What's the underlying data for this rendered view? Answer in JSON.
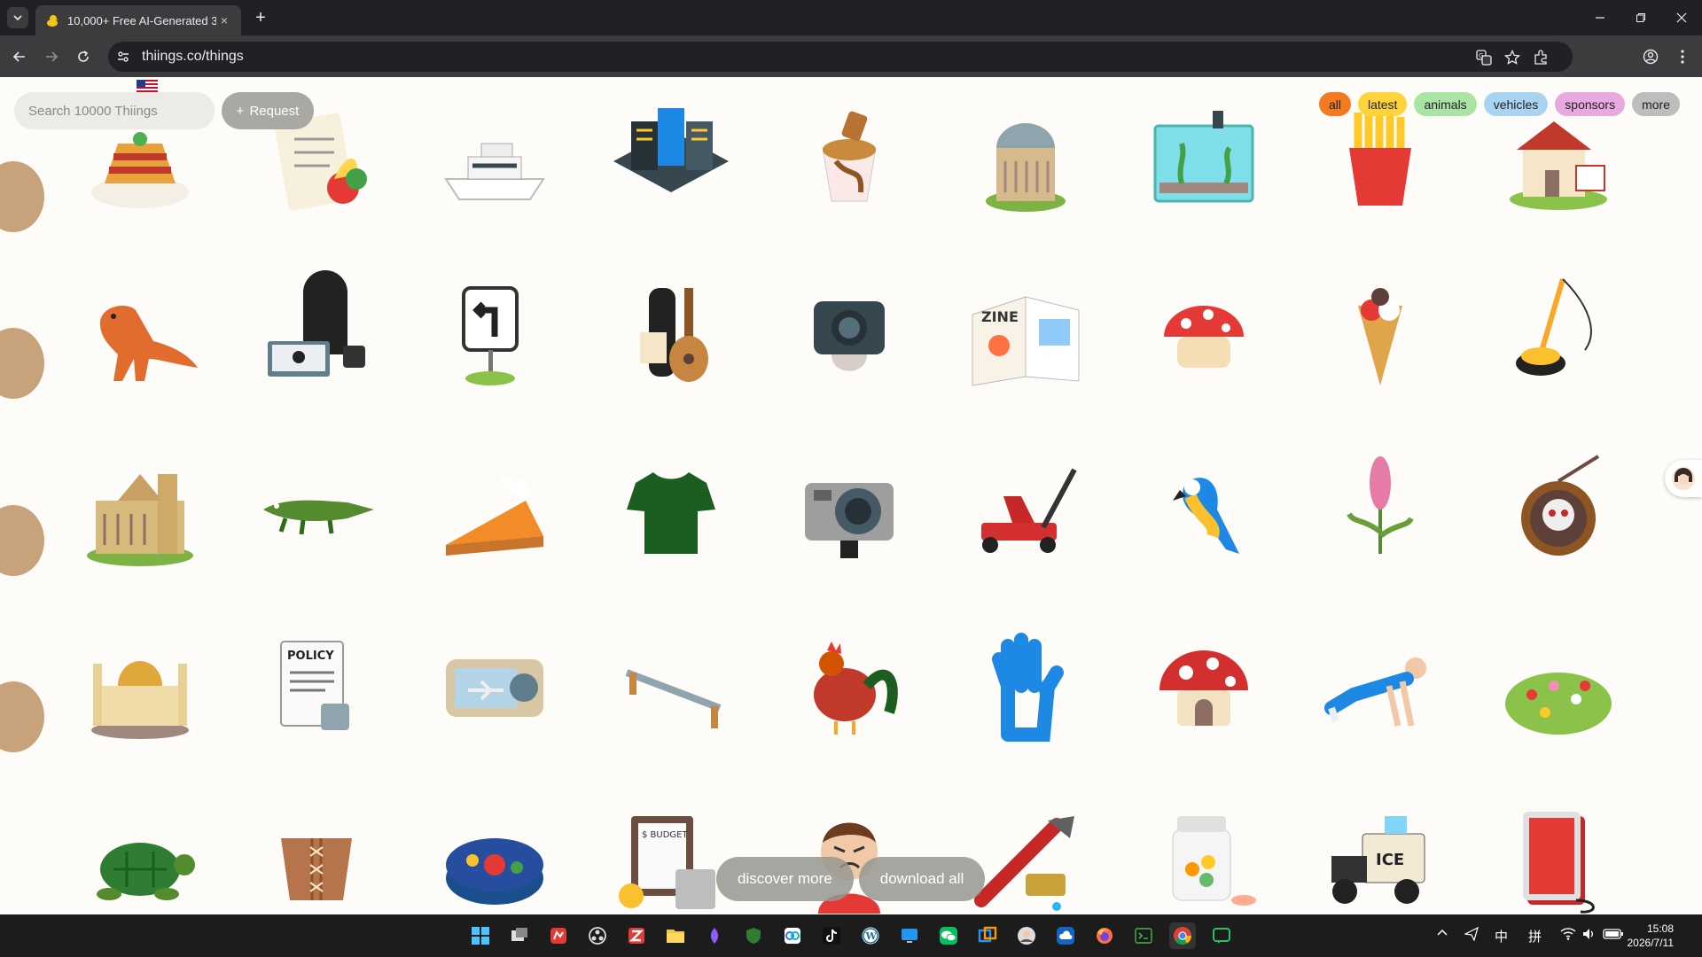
{
  "browser": {
    "tab_title": "10,000+ Free AI-Generated 3",
    "url": "thiings.co/things",
    "new_tab_label": "+",
    "close_tab_label": "×"
  },
  "page": {
    "search_placeholder": "Search 10000 Thiings",
    "request_label": "Request",
    "request_icon": "+",
    "filters": [
      {
        "label": "all",
        "color": "#f47a1f"
      },
      {
        "label": "latest",
        "color": "#ffd43b"
      },
      {
        "label": "animals",
        "color": "#a9e4a4"
      },
      {
        "label": "vehicles",
        "color": "#a8d4f2"
      },
      {
        "label": "sponsors",
        "color": "#e8a8e0"
      },
      {
        "label": "more",
        "color": "#bdbdbd"
      }
    ],
    "things": [
      [
        "pasta-bake",
        "grocery-list",
        "yacht",
        "city-block",
        "sundae",
        "observatory",
        "aquarium",
        "french-fries",
        "open-house"
      ],
      [
        "t-rex",
        "hacker",
        "left-turn-sign",
        "ukulele",
        "action-camera",
        "zine",
        "mushroom-bag",
        "bubble-waffle",
        "floor-buffer"
      ],
      [
        "cathedral",
        "crocodile",
        "pumpkin-pie",
        "green-t-shirt",
        "camera",
        "floor-jack",
        "macaw",
        "lupine-flower",
        "skull-amulet"
      ],
      [
        "mosque",
        "privacy-policy",
        "wind-tunnel",
        "balance-bar",
        "rooster",
        "rubber-glove",
        "mushroom-house",
        "push-up-man",
        "flower-garden"
      ],
      [
        "sea-turtle",
        "corset-belt",
        "enamel-box",
        "budget-calculator",
        "angry-boy",
        "pipe-wrench",
        "pill-bottle",
        "ice-truck",
        "led-panel"
      ]
    ],
    "discover_label": "discover more",
    "download_label": "download all"
  },
  "taskbar": {
    "time": "15:08",
    "date": "2026/7/11",
    "ime": "中",
    "ime2": "拼"
  }
}
